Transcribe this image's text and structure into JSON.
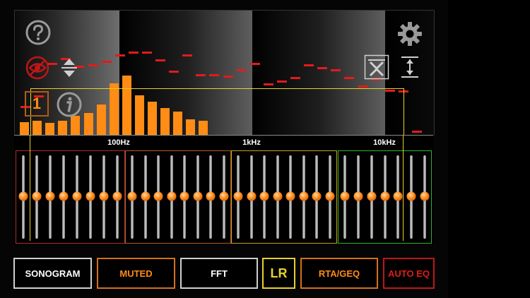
{
  "colors": {
    "rta_bar": "#ff8c14",
    "peak": "#e21b1b",
    "crosshair": "#e8d12a",
    "group_low": "#b0312a",
    "group_lowmid": "#b45a2a",
    "group_highmid": "#c9a21a",
    "group_high": "#2fb32f"
  },
  "axis": {
    "f100": "100Hz",
    "f1k": "1kHz",
    "f10k": "10kHz"
  },
  "overlay": {
    "channel_number": "1"
  },
  "buttons": {
    "sonogram": "SONOGRAM",
    "muted": "MUTED",
    "fft": "FFT",
    "lr": "LR",
    "rta_geq": "RTA/GEQ",
    "auto_eq": "AUTO EQ"
  },
  "icons": {
    "help": "help-icon",
    "settings": "gear-icon",
    "mute_view": "eye-off-icon",
    "vertical_scale": "vertical-scale-icon",
    "info": "info-icon",
    "zoom_toggle": "zoom-in-icon",
    "range": "range-icon"
  },
  "chart_data": {
    "type": "bar",
    "title": "",
    "xlabel": "",
    "ylabel": "",
    "xscale": "log",
    "bar_levels": [
      0.11,
      0.12,
      0.1,
      0.12,
      0.16,
      0.18,
      0.25,
      0.42,
      0.48,
      0.32,
      0.27,
      0.22,
      0.19,
      0.13,
      0.12
    ],
    "peak_levels": [
      0.24,
      0.32,
      0.58,
      0.62,
      0.56,
      0.57,
      0.6,
      0.65,
      0.67,
      0.67,
      0.61,
      0.52,
      0.65,
      0.49,
      0.49,
      0.48,
      0.53,
      0.58,
      0.42,
      0.44,
      0.47,
      0.57,
      0.55,
      0.53,
      0.47,
      0.4,
      0.46,
      0.37,
      0.36,
      0.04
    ],
    "eq_groups": [
      {
        "bands": 8,
        "gains": [
          0,
          0,
          0,
          0,
          0,
          0,
          0,
          0
        ]
      },
      {
        "bands": 8,
        "gains": [
          0,
          0,
          0,
          0,
          0,
          0,
          0,
          0
        ]
      },
      {
        "bands": 8,
        "gains": [
          0,
          0,
          0,
          0,
          0,
          0,
          0,
          0
        ]
      },
      {
        "bands": 7,
        "gains": [
          0,
          0,
          0,
          0,
          0,
          0,
          0
        ]
      }
    ]
  }
}
